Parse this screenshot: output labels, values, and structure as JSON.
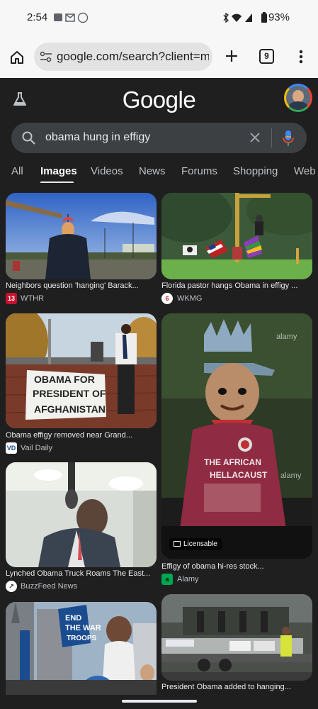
{
  "status": {
    "time": "2:54",
    "battery": "93%"
  },
  "browser": {
    "url": "google.com/search?client=ms",
    "tab_count": "9"
  },
  "google": {
    "logo": "Google"
  },
  "search": {
    "query": "obama hung in effigy"
  },
  "tabs": [
    "All",
    "Images",
    "Videos",
    "News",
    "Forums",
    "Shopping",
    "Web"
  ],
  "active_tab": "Images",
  "results": [
    {
      "title": "Neighbors question 'hanging' Barack...",
      "source": "WTHR",
      "fav": "13",
      "fav_color": "#c8102e"
    },
    {
      "title": "Florida pastor hangs Obama in effigy ...",
      "source": "WKMG",
      "fav": "6",
      "fav_color": "#d4242b"
    },
    {
      "title": "Obama effigy removed near Grand...",
      "source": "Vail Daily",
      "fav": "VD",
      "fav_color": "#ffffff"
    },
    {
      "title": "Effigy of obama hi-res stock...",
      "source": "Alamy",
      "fav": "a",
      "fav_color": "#00a651",
      "badge": "Licensable"
    },
    {
      "title": "Lynched Obama Truck Roams The East...",
      "source": "BuzzFeed News",
      "fav": "↗",
      "fav_color": "#ffffff"
    },
    {
      "title": "President Obama added to hanging...",
      "source": "",
      "fav": "",
      "fav_color": ""
    }
  ],
  "image_text": {
    "sign": "OBAMA FOR PRESIDENT OF AFGHANISTAN",
    "shirt": "THE AFRICAN HELLACAUST",
    "protest_sign": "END THE WAR TROOPS"
  }
}
